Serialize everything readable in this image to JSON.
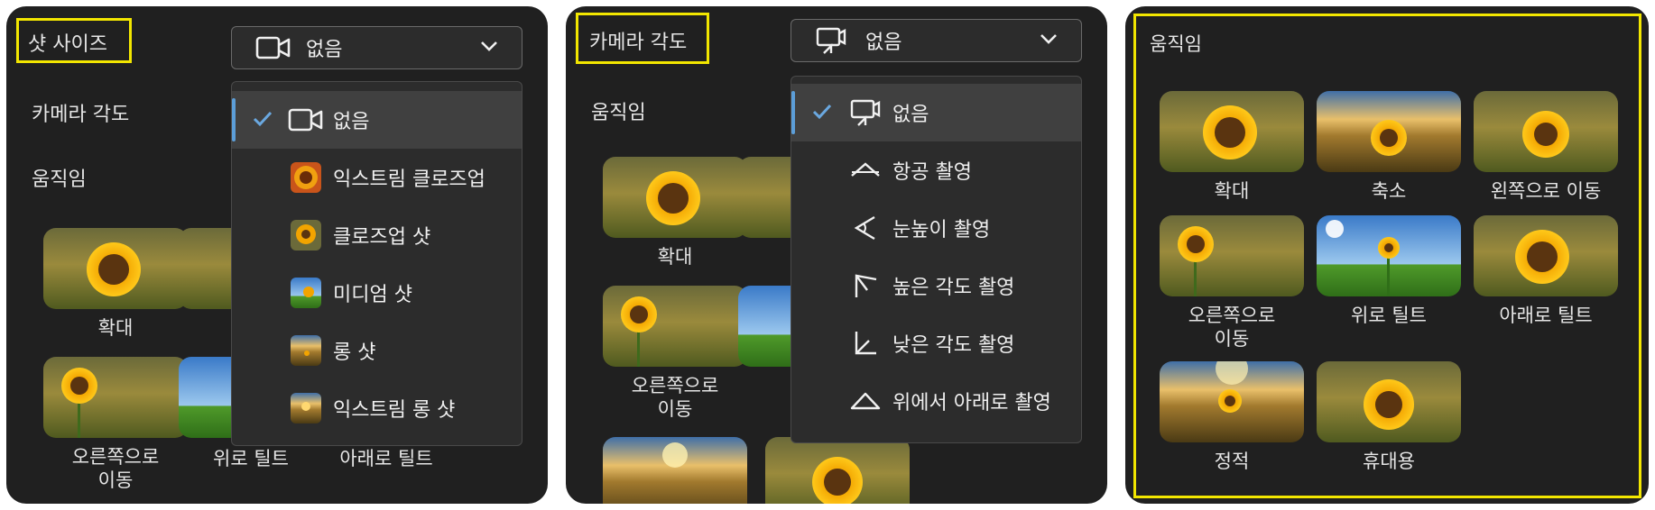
{
  "panel_left": {
    "shot_size_label": "샷 사이즈",
    "shot_size_value": "없음",
    "camera_angle_label": "카메라 각도",
    "motion_label": "움직임",
    "menu": [
      {
        "label": "없음",
        "icon": "video-camera-icon",
        "selected": true
      },
      {
        "label": "익스트림 클로즈업",
        "icon": "sunflower-thumbnail"
      },
      {
        "label": "클로즈업 샷",
        "icon": "sunflower-thumbnail"
      },
      {
        "label": "미디엄 샷",
        "icon": "sunflower-thumbnail"
      },
      {
        "label": "롱 샷",
        "icon": "sunflower-thumbnail"
      },
      {
        "label": "익스트림 롱 샷",
        "icon": "sunflower-thumbnail"
      }
    ],
    "tiles": [
      "확대",
      "오른쪽으로\n이동",
      "위로 틸트",
      "아래로 틸트"
    ]
  },
  "panel_middle": {
    "camera_angle_label": "카메라 각도",
    "camera_angle_value": "없음",
    "motion_label": "움직임",
    "menu": [
      {
        "label": "없음",
        "icon": "camera-angle-icon",
        "selected": true
      },
      {
        "label": "항공 촬영",
        "icon": "aerial-angle-icon"
      },
      {
        "label": "눈높이 촬영",
        "icon": "eye-level-angle-icon"
      },
      {
        "label": "높은 각도 촬영",
        "icon": "high-angle-icon"
      },
      {
        "label": "낮은 각도 촬영",
        "icon": "low-angle-icon"
      },
      {
        "label": "위에서 아래로 촬영",
        "icon": "top-down-angle-icon"
      }
    ],
    "tiles": [
      "확대",
      "오른쪽으로\n이동"
    ]
  },
  "panel_right": {
    "motion_label": "움직임",
    "tiles": [
      "확대",
      "축소",
      "왼쪽으로 이동",
      "오른쪽으로\n이동",
      "위로 틸트",
      "아래로 틸트",
      "정적",
      "휴대용"
    ]
  },
  "colors": {
    "panel_bg": "#202020",
    "highlight": "#f2e600",
    "accent": "#5c9ed8"
  }
}
